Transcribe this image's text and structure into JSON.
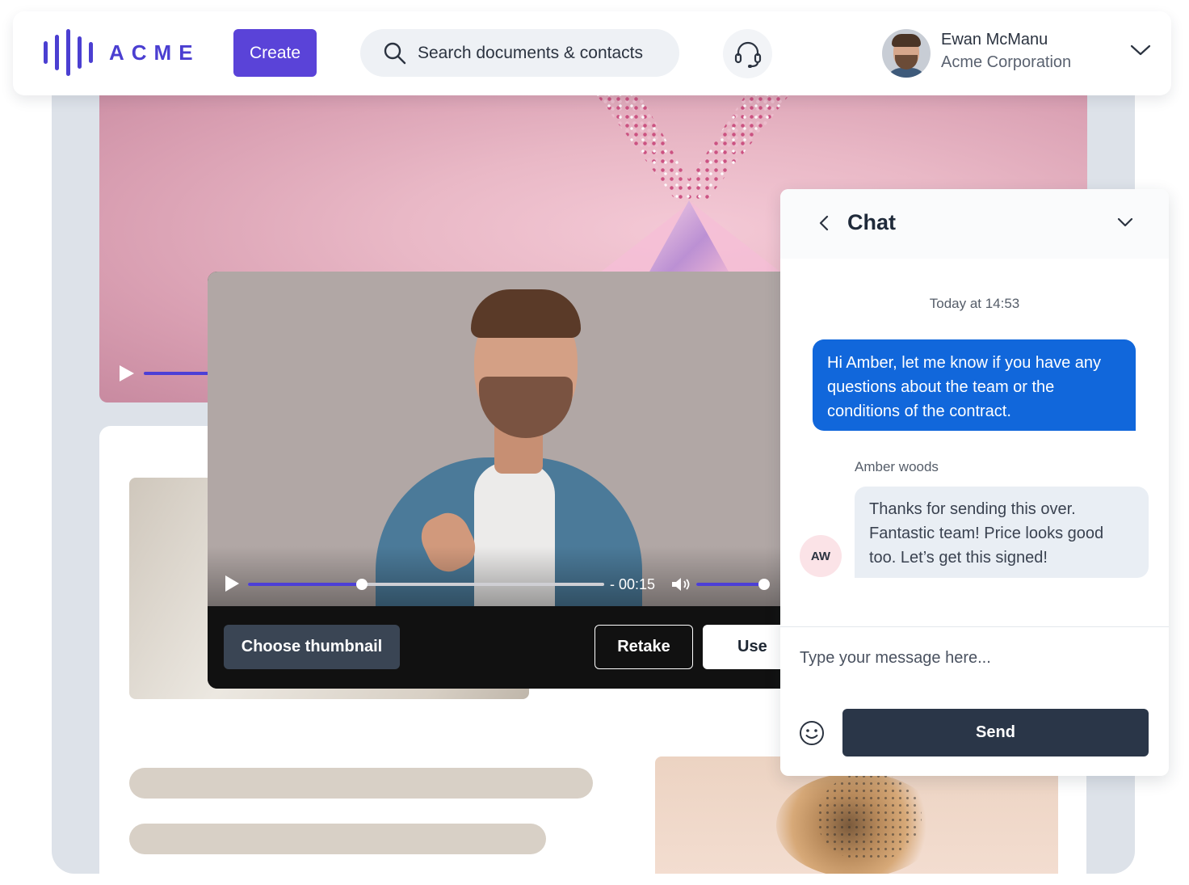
{
  "brand": {
    "name": "ACME",
    "accent": "#4b3fd1"
  },
  "header": {
    "create_label": "Create",
    "search_placeholder": "Search documents & contacts",
    "support_icon": "headset-icon",
    "user": {
      "name": "Ewan McManu",
      "organization": "Acme Corporation"
    }
  },
  "recorder": {
    "time": "- 00:15",
    "playback_progress": 0.32,
    "volume_level": 1.0,
    "buttons": {
      "thumbnail": "Choose thumbnail",
      "retake": "Retake",
      "use": "Use"
    }
  },
  "chat": {
    "title": "Chat",
    "timestamp": "Today at 14:53",
    "messages": [
      {
        "direction": "outgoing",
        "text": "Hi Amber, let me know if you have any questions about the team or the conditions of the contract."
      },
      {
        "direction": "incoming",
        "sender": "Amber woods",
        "initials": "AW",
        "text": "Thanks for sending this over. Fantastic team! Price looks good too. Let’s get this signed!"
      }
    ],
    "input_placeholder": "Type your message here...",
    "send_label": "Send"
  },
  "colors": {
    "outgoing_bubble": "#1167db",
    "incoming_bubble": "#e9eef4",
    "send_button": "#2a3648",
    "progress": "#4c3fd6"
  }
}
